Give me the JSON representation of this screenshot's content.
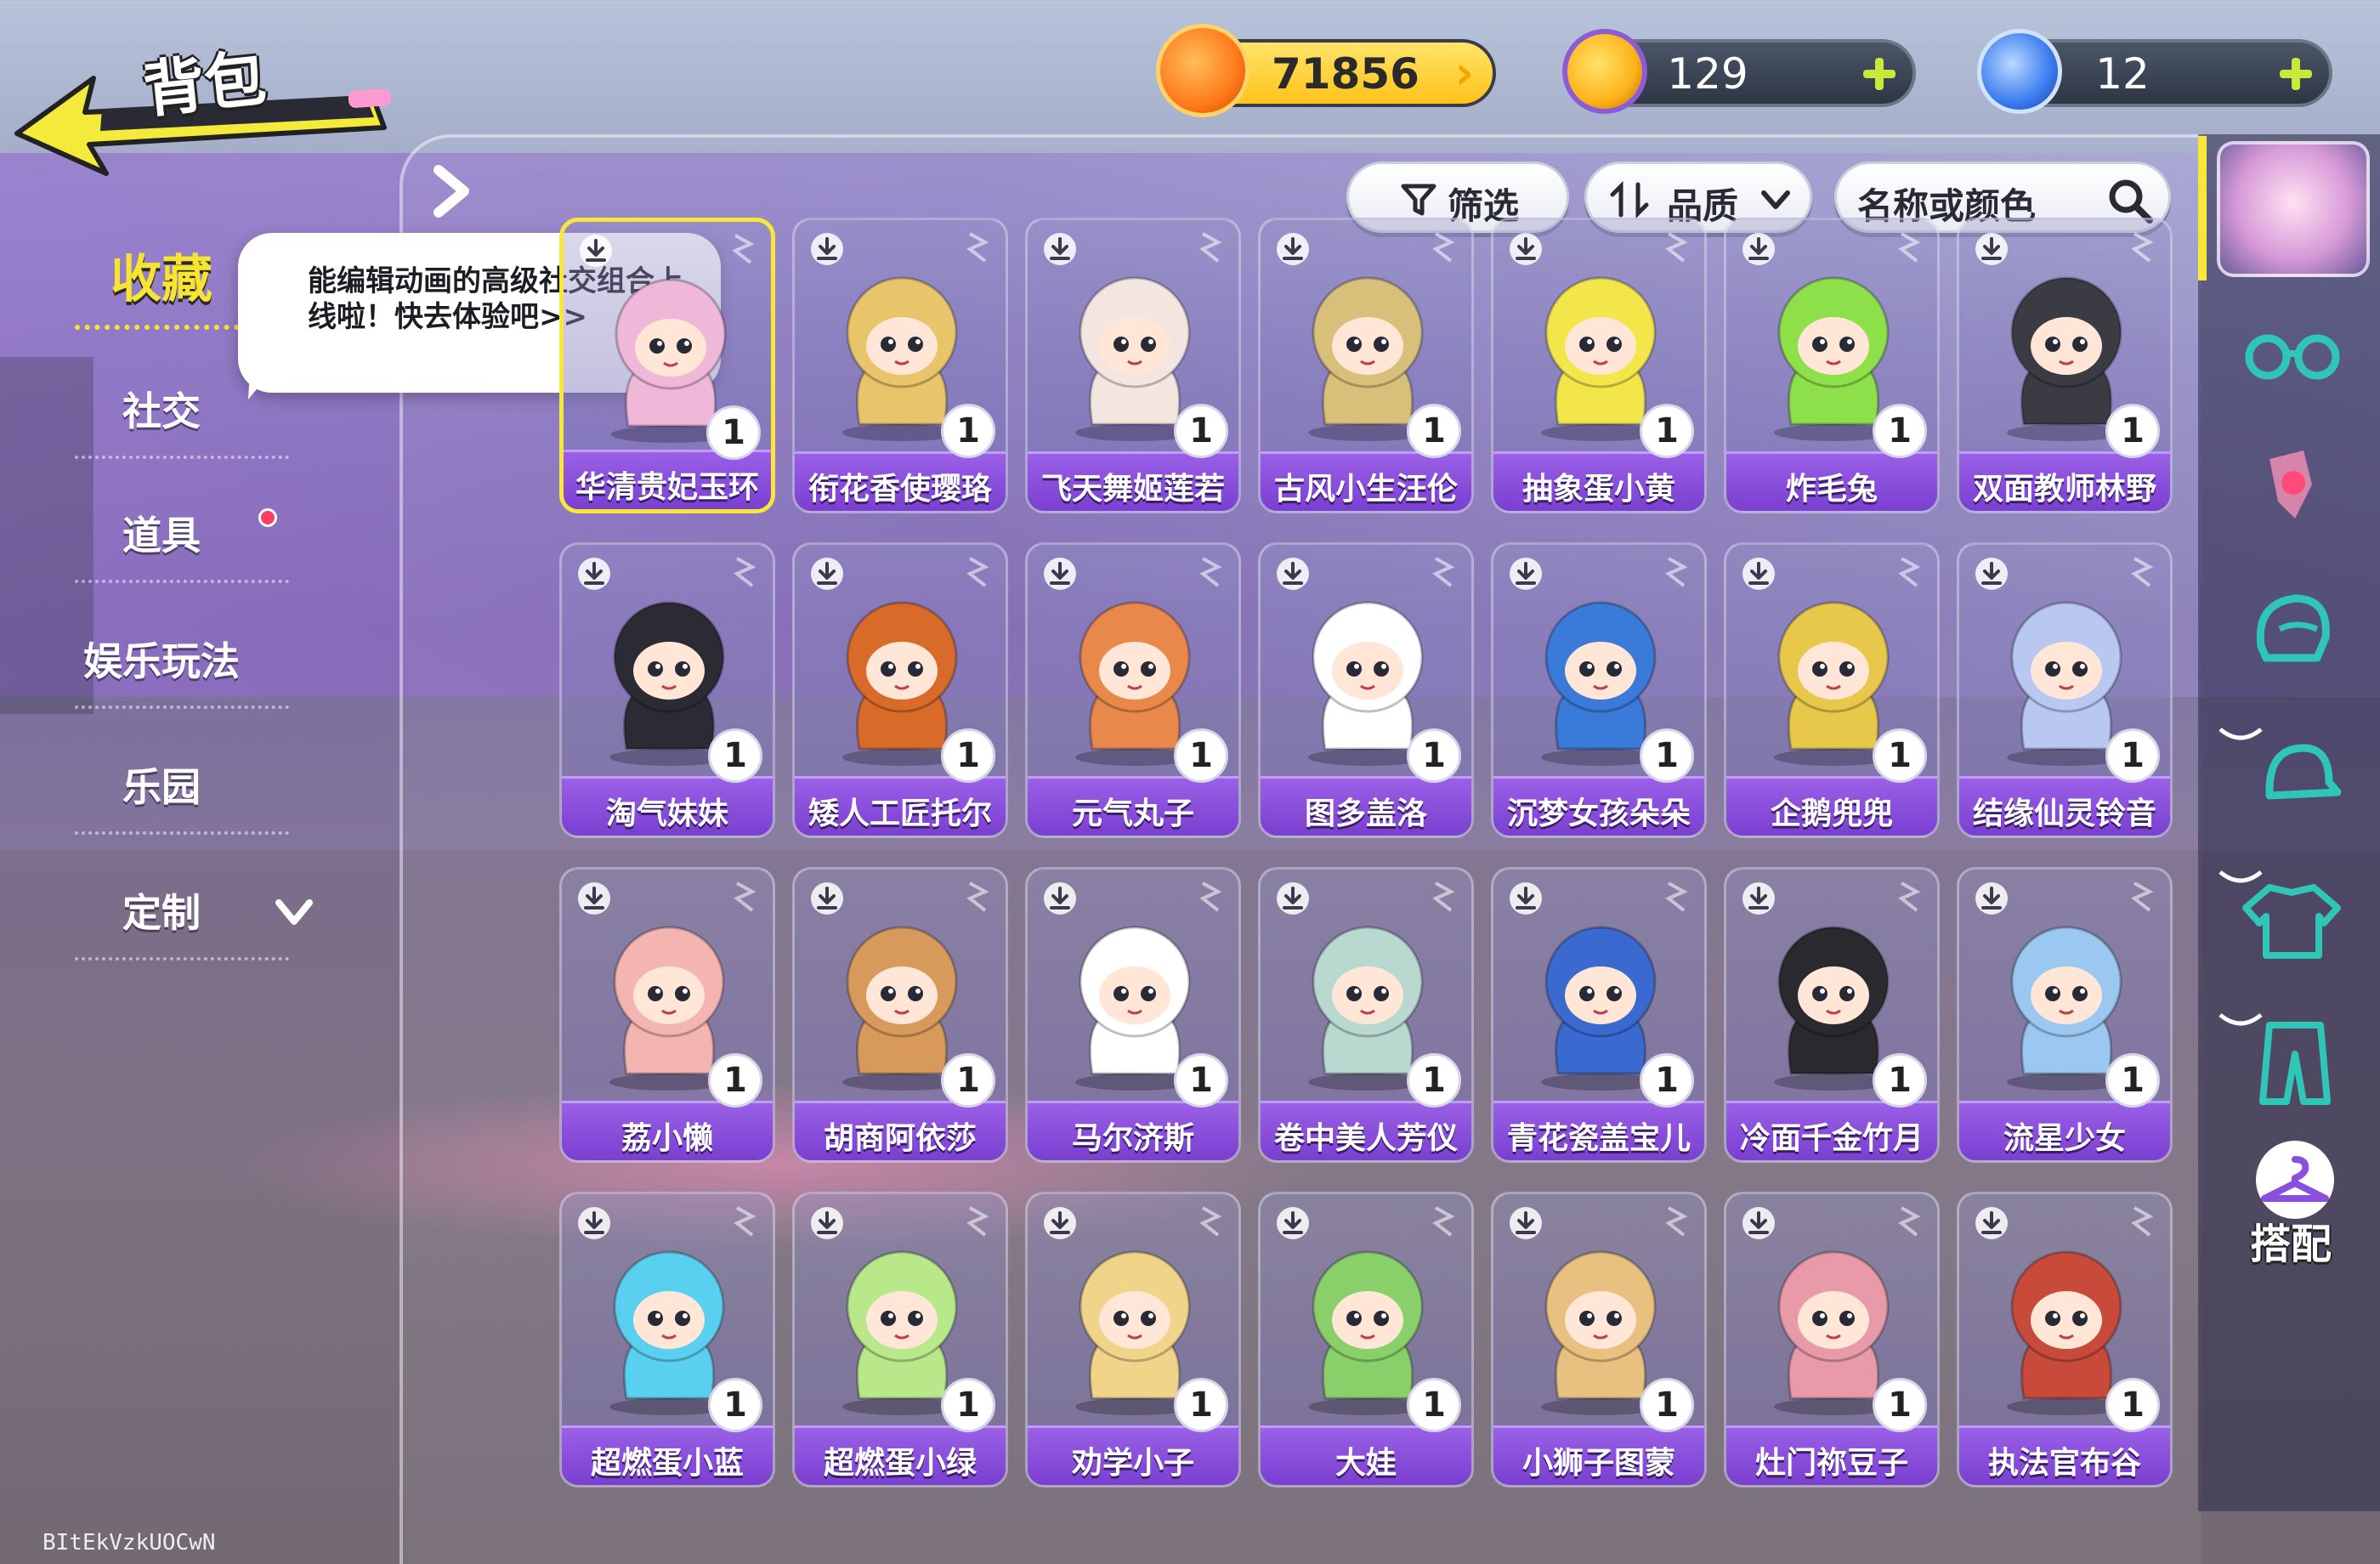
{
  "page": {
    "title": "背包"
  },
  "currencies": [
    {
      "name": "gold",
      "value": "71856"
    },
    {
      "name": "coin",
      "value": "129"
    },
    {
      "name": "gem",
      "value": "12"
    }
  ],
  "toolbar": {
    "filter_label": "筛选",
    "quality_label": "品质",
    "search_placeholder": "名称或颜色"
  },
  "nav": {
    "items": [
      {
        "label": "收藏",
        "active": true
      },
      {
        "label": "社交"
      },
      {
        "label": "道具",
        "badge": true
      },
      {
        "label": "娱乐玩法"
      },
      {
        "label": "乐园"
      },
      {
        "label": "定制",
        "expandable": true
      }
    ]
  },
  "tooltip": {
    "text": "能编辑动画的高级社交组合上线啦！快去体验吧>>"
  },
  "grid": {
    "items": [
      {
        "name": "华清贵妃玉环",
        "count": "1",
        "color": "#f0b8d8",
        "selected": true
      },
      {
        "name": "衔花香使璎珞",
        "count": "1",
        "color": "#e8c46a"
      },
      {
        "name": "飞天舞姬莲若",
        "count": "1",
        "color": "#f3e6e0"
      },
      {
        "name": "古风小生汪伦",
        "count": "1",
        "color": "#d9c07a"
      },
      {
        "name": "抽象蛋小黄",
        "count": "1",
        "color": "#f2e64a"
      },
      {
        "name": "炸毛兔",
        "count": "1",
        "color": "#8ee04a"
      },
      {
        "name": "双面教师林野",
        "count": "1",
        "color": "#3b3b44"
      },
      {
        "name": "淘气妹妹",
        "count": "1",
        "color": "#2b2b34"
      },
      {
        "name": "矮人工匠托尔",
        "count": "1",
        "color": "#d86a2a"
      },
      {
        "name": "元气丸子",
        "count": "1",
        "color": "#e8884a"
      },
      {
        "name": "图多盖洛",
        "count": "1",
        "color": "#ffffff"
      },
      {
        "name": "沉梦女孩朵朵",
        "count": "1",
        "color": "#3a7ad8"
      },
      {
        "name": "企鹅兜兜",
        "count": "1",
        "color": "#e8c84a"
      },
      {
        "name": "结缘仙灵铃音",
        "count": "1",
        "color": "#b8c8f0"
      },
      {
        "name": "荔小懒",
        "count": "1",
        "color": "#f4b4b0"
      },
      {
        "name": "胡商阿依莎",
        "count": "1",
        "color": "#d89a5a"
      },
      {
        "name": "马尔济斯",
        "count": "1",
        "color": "#ffffff"
      },
      {
        "name": "卷中美人芳仪",
        "count": "1",
        "color": "#b8d8d0"
      },
      {
        "name": "青花瓷盖宝儿",
        "count": "1",
        "color": "#3a6ad0"
      },
      {
        "name": "冷面千金竹月",
        "count": "1",
        "color": "#2a2a2e"
      },
      {
        "name": "流星少女",
        "count": "1",
        "color": "#9ac8f0"
      },
      {
        "name": "超燃蛋小蓝",
        "count": "1",
        "color": "#5ad0f0"
      },
      {
        "name": "超燃蛋小绿",
        "count": "1",
        "color": "#b8e88a"
      },
      {
        "name": "劝学小子",
        "count": "1",
        "color": "#f0d48a"
      },
      {
        "name": "大娃",
        "count": "1",
        "color": "#8ad06a"
      },
      {
        "name": "小狮子图蒙",
        "count": "1",
        "color": "#e8c080"
      },
      {
        "name": "灶门祢豆子",
        "count": "1",
        "color": "#e89aa8"
      },
      {
        "name": "执法官布谷",
        "count": "1",
        "color": "#c84a3a"
      }
    ]
  },
  "sidebar": {
    "tabs": [
      "glasses-icon",
      "accessory-icon",
      "hair-icon",
      "hat-icon",
      "top-icon",
      "pants-icon"
    ],
    "dress_label": "搭配"
  },
  "footer": {
    "code": "BItEkVzkUOCwN"
  },
  "colors": {
    "accent": "#f8e738",
    "name_bar": "#8a4fdc",
    "badge": "#ff3d62"
  }
}
